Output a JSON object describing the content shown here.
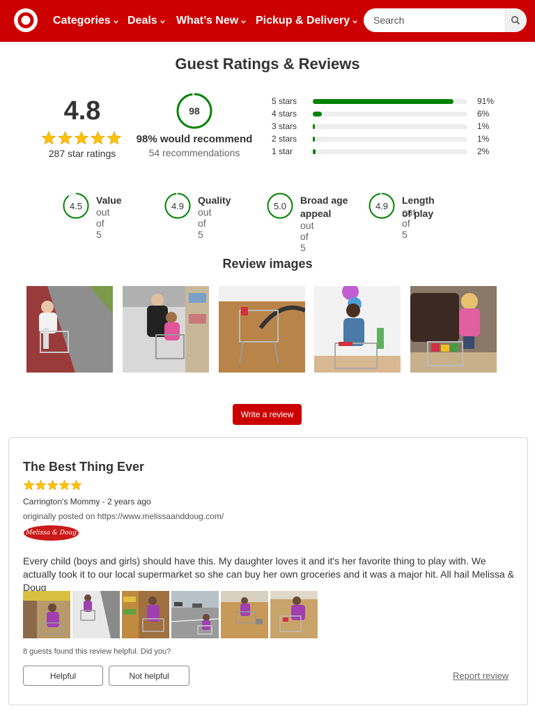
{
  "header": {
    "brand": "Target",
    "nav": [
      "Categories",
      "Deals",
      "What’s New",
      "Pickup & Delivery"
    ],
    "search_placeholder": "Search"
  },
  "colors": {
    "brand": "#cc0000",
    "rating_green": "#008300",
    "star": "#ffc107"
  },
  "page_title": "Guest Ratings & Reviews",
  "summary": {
    "average": "4.8",
    "average_value": 4.8,
    "star_ratings": "287 star ratings",
    "recommend_number": "98",
    "recommend_fraction": 0.98,
    "recommend_text": "98% would recommend",
    "recommendations": "54 recommendations"
  },
  "distribution": [
    {
      "label": "5 stars",
      "pct": "91%",
      "value": 91
    },
    {
      "label": "4 stars",
      "pct": "6%",
      "value": 6
    },
    {
      "label": "3 stars",
      "pct": "1%",
      "value": 1
    },
    {
      "label": "2 stars",
      "pct": "1%",
      "value": 1
    },
    {
      "label": "1 star",
      "pct": "2%",
      "value": 2
    }
  ],
  "attributes": [
    {
      "value": "4.5",
      "score": 4.5,
      "name": "Value",
      "sub": "out of 5"
    },
    {
      "value": "4.9",
      "score": 4.9,
      "name": "Quality",
      "sub": "out of 5"
    },
    {
      "value": "5.0",
      "score": 5.0,
      "name": "Broad age appeal",
      "sub": "out of 5"
    },
    {
      "value": "4.9",
      "score": 4.9,
      "name": "Length of play",
      "sub": "out of 5"
    }
  ],
  "review_images_title": "Review images",
  "write_review": "Write a review",
  "review": {
    "title": "The Best Thing Ever",
    "rating": 5,
    "author": "Carrington's Mommy - 2 years ago",
    "source": "originally posted on https://www.melissaanddoug.com/",
    "source_logo": "Melissa & Doug",
    "body": "Every child (boys and girls) should have this. My daughter loves it and it's her favorite thing to play with. We actually took it to our local supermarket so she can buy her own groceries and it was a major hit. All hail Melissa & Doug",
    "helpful_count": "8 guests found this review helpful. Did you?",
    "helpful": "Helpful",
    "not_helpful": "Not helpful",
    "report": "Report review"
  }
}
